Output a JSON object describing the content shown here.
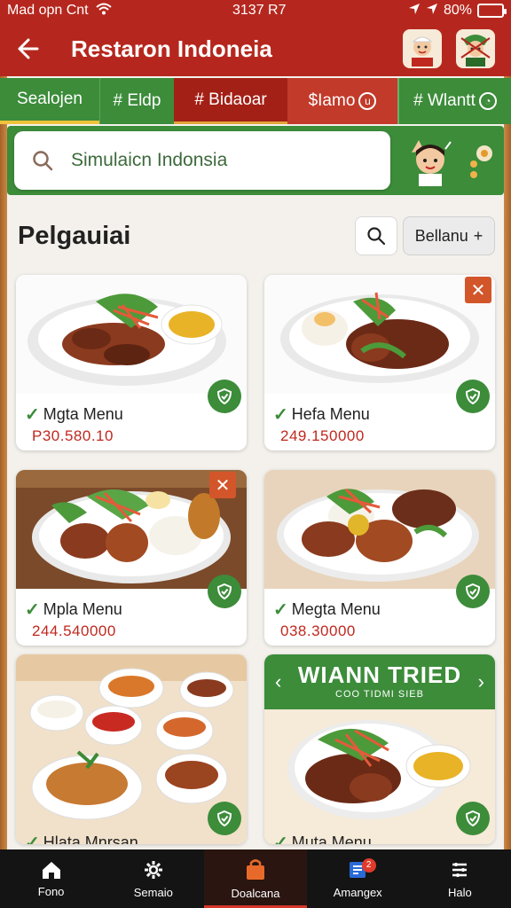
{
  "status_bar": {
    "carrier": "Mad opn Cnt",
    "time": "3137 R7",
    "battery": "80%"
  },
  "app_bar": {
    "title": "Restaron Indoneia"
  },
  "tabs": [
    {
      "label": "Sealojen",
      "icon": ""
    },
    {
      "label": "Eldp",
      "icon": "#"
    },
    {
      "label": "Bidaoar",
      "icon": "#"
    },
    {
      "label": "Iamo",
      "icon": "$"
    },
    {
      "label": "Wlantt",
      "icon": "#"
    }
  ],
  "search": {
    "value": "Simulaicn Indonsia",
    "placeholder": "Simulaicn Indonsia"
  },
  "section": {
    "title": "Pelgauiai",
    "sort_label": "Bellanu"
  },
  "menu_items": [
    {
      "name": "Mgta Menu",
      "price": "P30.580.10"
    },
    {
      "name": "Hefa Menu",
      "price": "249.150000"
    },
    {
      "name": "Mpla Menu",
      "price": "244.540000"
    },
    {
      "name": "Megta Menu",
      "price": "038.30000"
    },
    {
      "name": "Hlata Mnrsan",
      "price": ""
    },
    {
      "name": "Muta Menu",
      "price": ""
    }
  ],
  "promo": {
    "title": "WIANN TRIED",
    "subtitle": "COO TIDMI SIEB"
  },
  "bottom_nav": [
    {
      "label": "Fono",
      "icon": "home-icon"
    },
    {
      "label": "Semaio",
      "icon": "gear-icon"
    },
    {
      "label": "Doalcana",
      "icon": "bag-icon"
    },
    {
      "label": "Amangex",
      "icon": "cart-icon",
      "badge": "2"
    },
    {
      "label": "Halo",
      "icon": "menu-icon"
    }
  ],
  "colors": {
    "primary_red": "#b5271e",
    "primary_green": "#3c8c3a",
    "price_red": "#c0281f"
  }
}
